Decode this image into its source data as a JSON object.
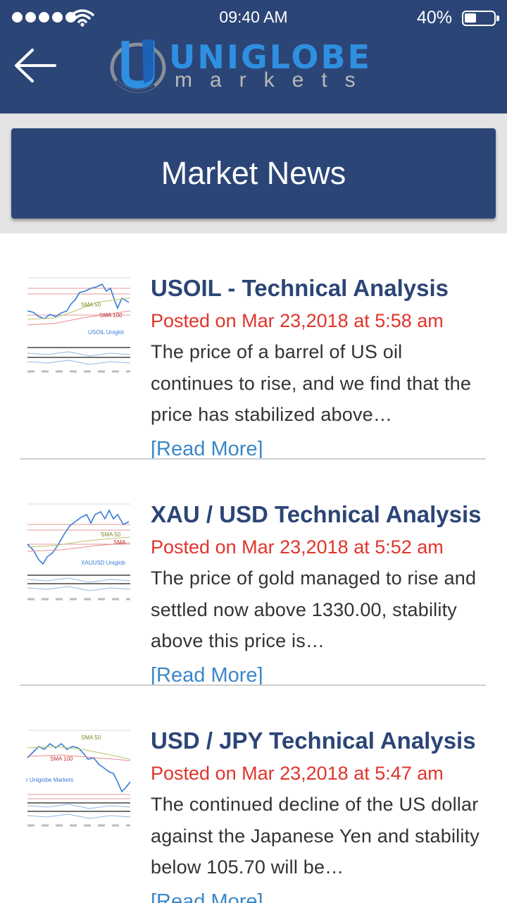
{
  "status_bar": {
    "time": "09:40 AM",
    "battery": "40%"
  },
  "header": {
    "logo_top": "UNIGLOBE",
    "logo_bottom": "markets"
  },
  "banner": {
    "title": "Market News"
  },
  "articles": [
    {
      "title": "USOIL - Technical Analysis",
      "posted": "Posted on Mar 23,2018 at 5:58 am",
      "excerpt": "The price of a barrel of US oil continues to rise, and we find that the price has stabilized above…",
      "read_more": "[Read More]"
    },
    {
      "title": "XAU / USD Technical Analysis",
      "posted": "Posted on Mar 23,2018 at 5:52 am",
      "excerpt": "The price of gold managed to rise and settled now above 1330.00, stability above this price is…",
      "read_more": "[Read More]"
    },
    {
      "title": "USD / JPY Technical Analysis",
      "posted": "Posted on Mar 23,2018 at 5:47 am",
      "excerpt": "The continued decline of the US dollar against the Japanese Yen and stability below 105.70 will be…",
      "read_more": "[Read More]"
    }
  ],
  "thumbnails": [
    {
      "sma_a": "SMA 50",
      "sma_b": "SMA 100",
      "watermark": "USOIL Uniglot"
    },
    {
      "sma_a": "SMA 50",
      "sma_b": "SMA",
      "watermark": "XAUUSD Uniglob"
    },
    {
      "sma_a": "SMA 50",
      "sma_b": "SMA 100",
      "watermark": "r Uniglobe Markets"
    }
  ],
  "colors": {
    "primary": "#2c4577",
    "accent_red": "#e0342b",
    "link": "#3b87c8",
    "logo_blue": "#2f8fe0"
  },
  "icons": {
    "back": "arrow-left-icon",
    "wifi": "wifi-icon",
    "battery": "battery-icon",
    "signal": "signal-dots-icon"
  }
}
